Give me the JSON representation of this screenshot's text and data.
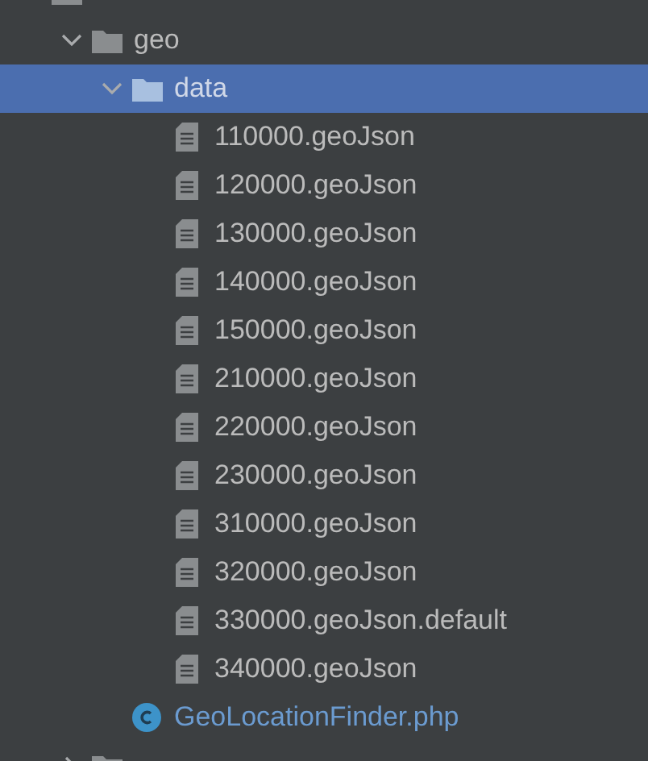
{
  "project_tree": [
    {
      "kind": "folder",
      "selected": false,
      "children": [
        {
          "kind": "folder",
          "name": "geo",
          "expanded": true,
          "selected": false,
          "children": [
            {
              "kind": "folder",
              "name": "data",
              "expanded": true,
              "selected": true,
              "children": [
                {
                  "kind": "file",
                  "name": "110000.geoJson",
                  "selected": false
                },
                {
                  "kind": "file",
                  "name": "120000.geoJson",
                  "selected": false
                },
                {
                  "kind": "file",
                  "name": "130000.geoJson",
                  "selected": false
                },
                {
                  "kind": "file",
                  "name": "140000.geoJson",
                  "selected": false
                },
                {
                  "kind": "file",
                  "name": "150000.geoJson",
                  "selected": false
                },
                {
                  "kind": "file",
                  "name": "210000.geoJson",
                  "selected": false
                },
                {
                  "kind": "file",
                  "name": "220000.geoJson",
                  "selected": false
                },
                {
                  "kind": "file",
                  "name": "230000.geoJson",
                  "selected": false
                },
                {
                  "kind": "file",
                  "name": "310000.geoJson",
                  "selected": false
                },
                {
                  "kind": "file",
                  "name": "320000.geoJson",
                  "selected": false
                },
                {
                  "kind": "file",
                  "name": "330000.geoJson.default",
                  "selected": false
                },
                {
                  "kind": "file",
                  "name": "340000.geoJson",
                  "selected": false
                }
              ]
            },
            {
              "kind": "php-class",
              "name": "GeoLocationFinder.php",
              "selected": false
            }
          ]
        },
        {
          "kind": "folder",
          "expanded": false,
          "selected": false
        }
      ]
    }
  ]
}
